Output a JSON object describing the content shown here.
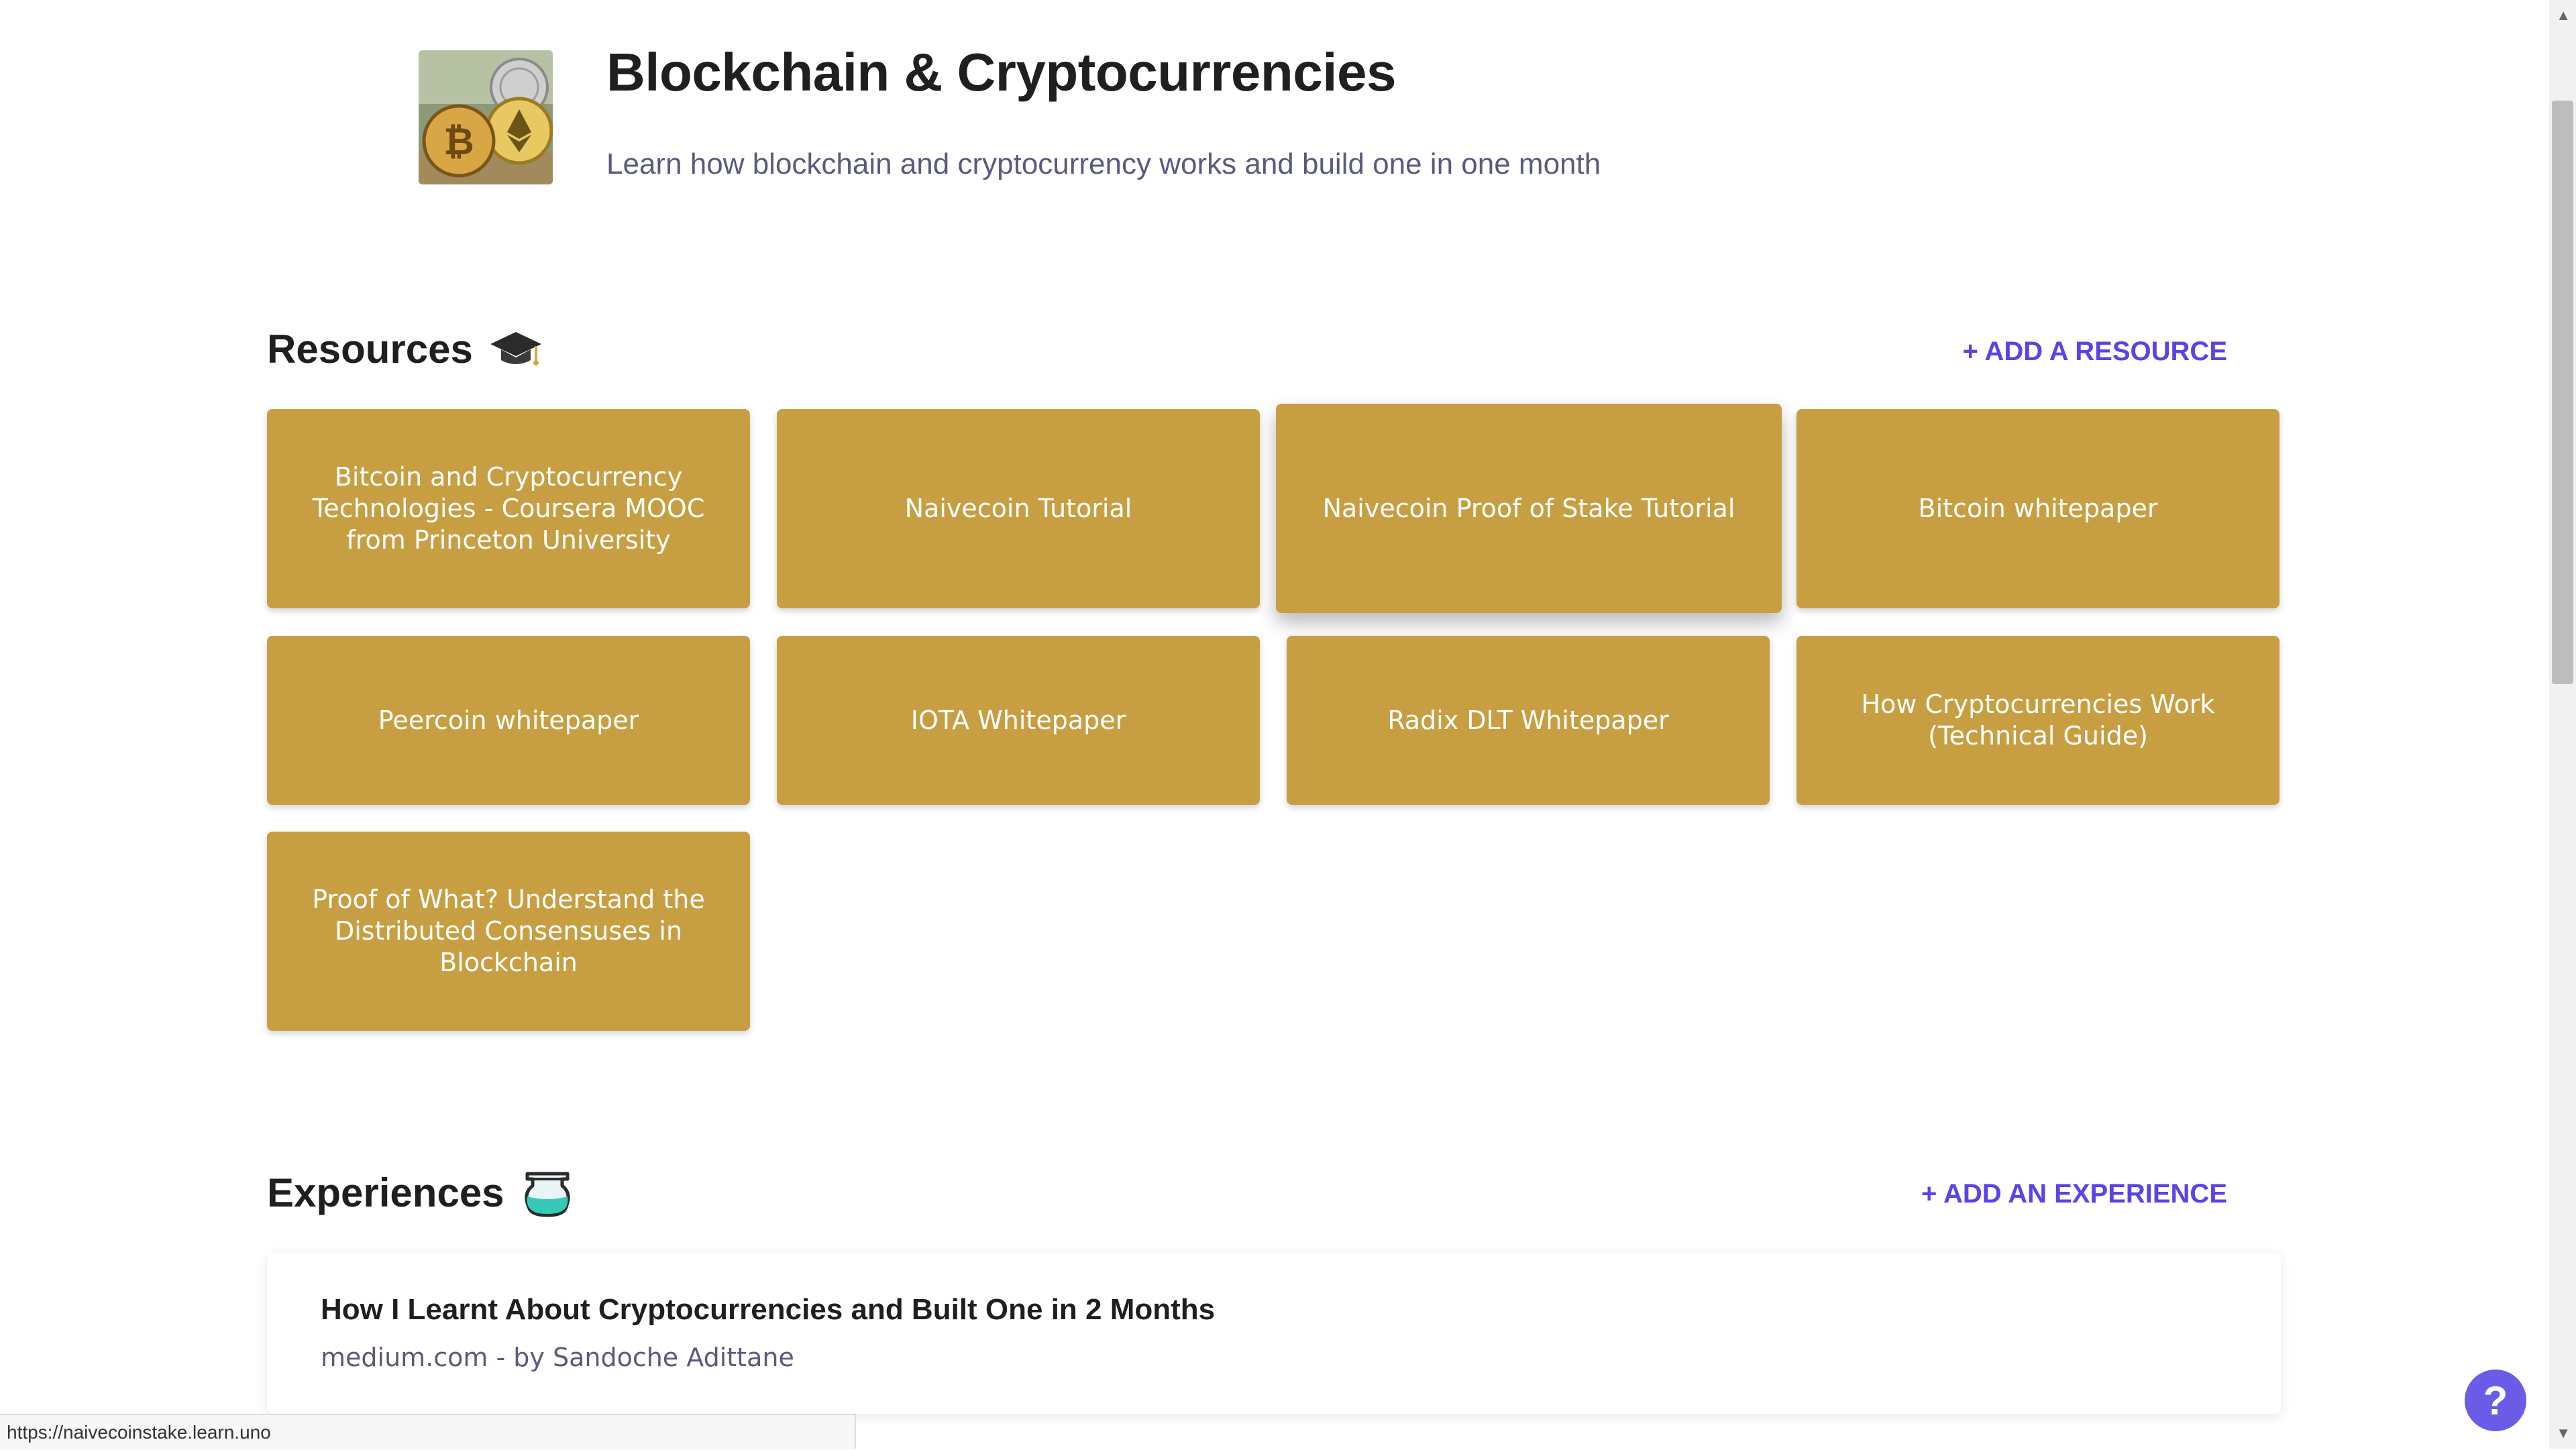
{
  "topic": {
    "title": "Blockchain & Cryptocurrencies",
    "subtitle": "Learn how blockchain and cryptocurrency works and build one in one month"
  },
  "resources": {
    "heading": "Resources",
    "heading_icon": "graduation-cap-icon",
    "add_label": "+ ADD A RESOURCE",
    "items": [
      {
        "label": "Bitcoin and Cryptocurrency Technologies - Coursera MOOC from Princeton University"
      },
      {
        "label": "Naivecoin Tutorial"
      },
      {
        "label": "Naivecoin Proof of Stake Tutorial"
      },
      {
        "label": "Bitcoin whitepaper"
      },
      {
        "label": "Peercoin whitepaper"
      },
      {
        "label": "IOTA Whitepaper"
      },
      {
        "label": "Radix DLT Whitepaper"
      },
      {
        "label": "How Cryptocurrencies Work (Technical Guide)"
      },
      {
        "label": "Proof of What? Understand the Distributed Consensuses in Blockchain"
      }
    ]
  },
  "experiences": {
    "heading": "Experiences",
    "heading_icon": "flask-icon",
    "add_label": "+ ADD AN EXPERIENCE",
    "items": [
      {
        "title": "How I Learnt About Cryptocurrencies and Built One in 2 Months",
        "meta": "medium.com - by Sandoche Adittane"
      }
    ]
  },
  "status_bar": {
    "url": "https://naivecoinstake.learn.uno"
  },
  "help": {
    "label": "?"
  },
  "colors": {
    "card": "#c79f42",
    "accent": "#5a44e6",
    "help": "#6b5ce7"
  }
}
